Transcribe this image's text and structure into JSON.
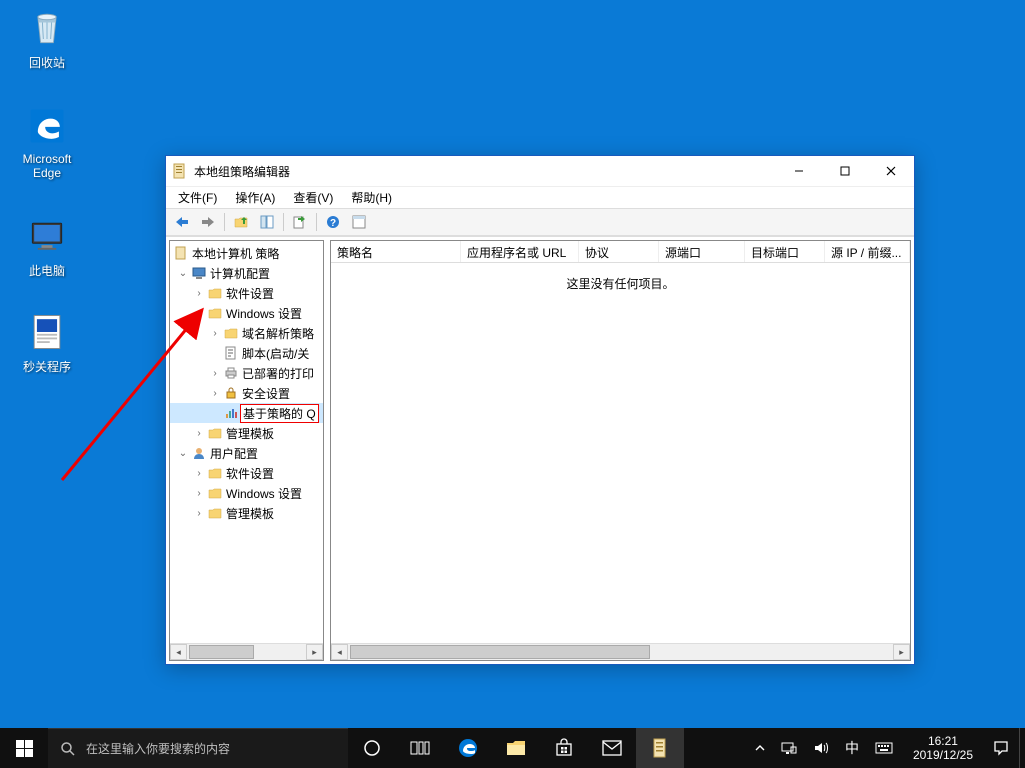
{
  "desktop": {
    "icons": [
      {
        "id": "recycle-bin",
        "label": "回收站"
      },
      {
        "id": "edge",
        "label": "Microsoft Edge"
      },
      {
        "id": "this-pc",
        "label": "此电脑"
      },
      {
        "id": "shutdown-tool",
        "label": "秒关程序"
      }
    ]
  },
  "window": {
    "title": "本地组策略编辑器",
    "menu": {
      "file": "文件(F)",
      "action": "操作(A)",
      "view": "查看(V)",
      "help": "帮助(H)"
    },
    "tree": {
      "root": "本地计算机 策略",
      "computer_config": "计算机配置",
      "software_settings": "软件设置",
      "windows_settings": "Windows 设置",
      "dns_policy": "域名解析策略",
      "scripts": "脚本(启动/关",
      "deployed_printers": "已部署的打印",
      "security_settings": "安全设置",
      "policy_based_qos": "基于策略的 Q",
      "admin_templates": "管理模板",
      "user_config": "用户配置",
      "user_software_settings": "软件设置",
      "user_windows_settings": "Windows 设置",
      "user_admin_templates": "管理模板"
    },
    "columns": {
      "name": "策略名",
      "app_or_url": "应用程序名或 URL",
      "protocol": "协议",
      "src_port": "源端口",
      "dst_port": "目标端口",
      "src_ip": "源 IP / 前缀..."
    },
    "empty_message": "这里没有任何项目。"
  },
  "taskbar": {
    "search_placeholder": "在这里输入你要搜索的内容",
    "ime": "中",
    "time": "16:21",
    "date": "2019/12/25"
  }
}
